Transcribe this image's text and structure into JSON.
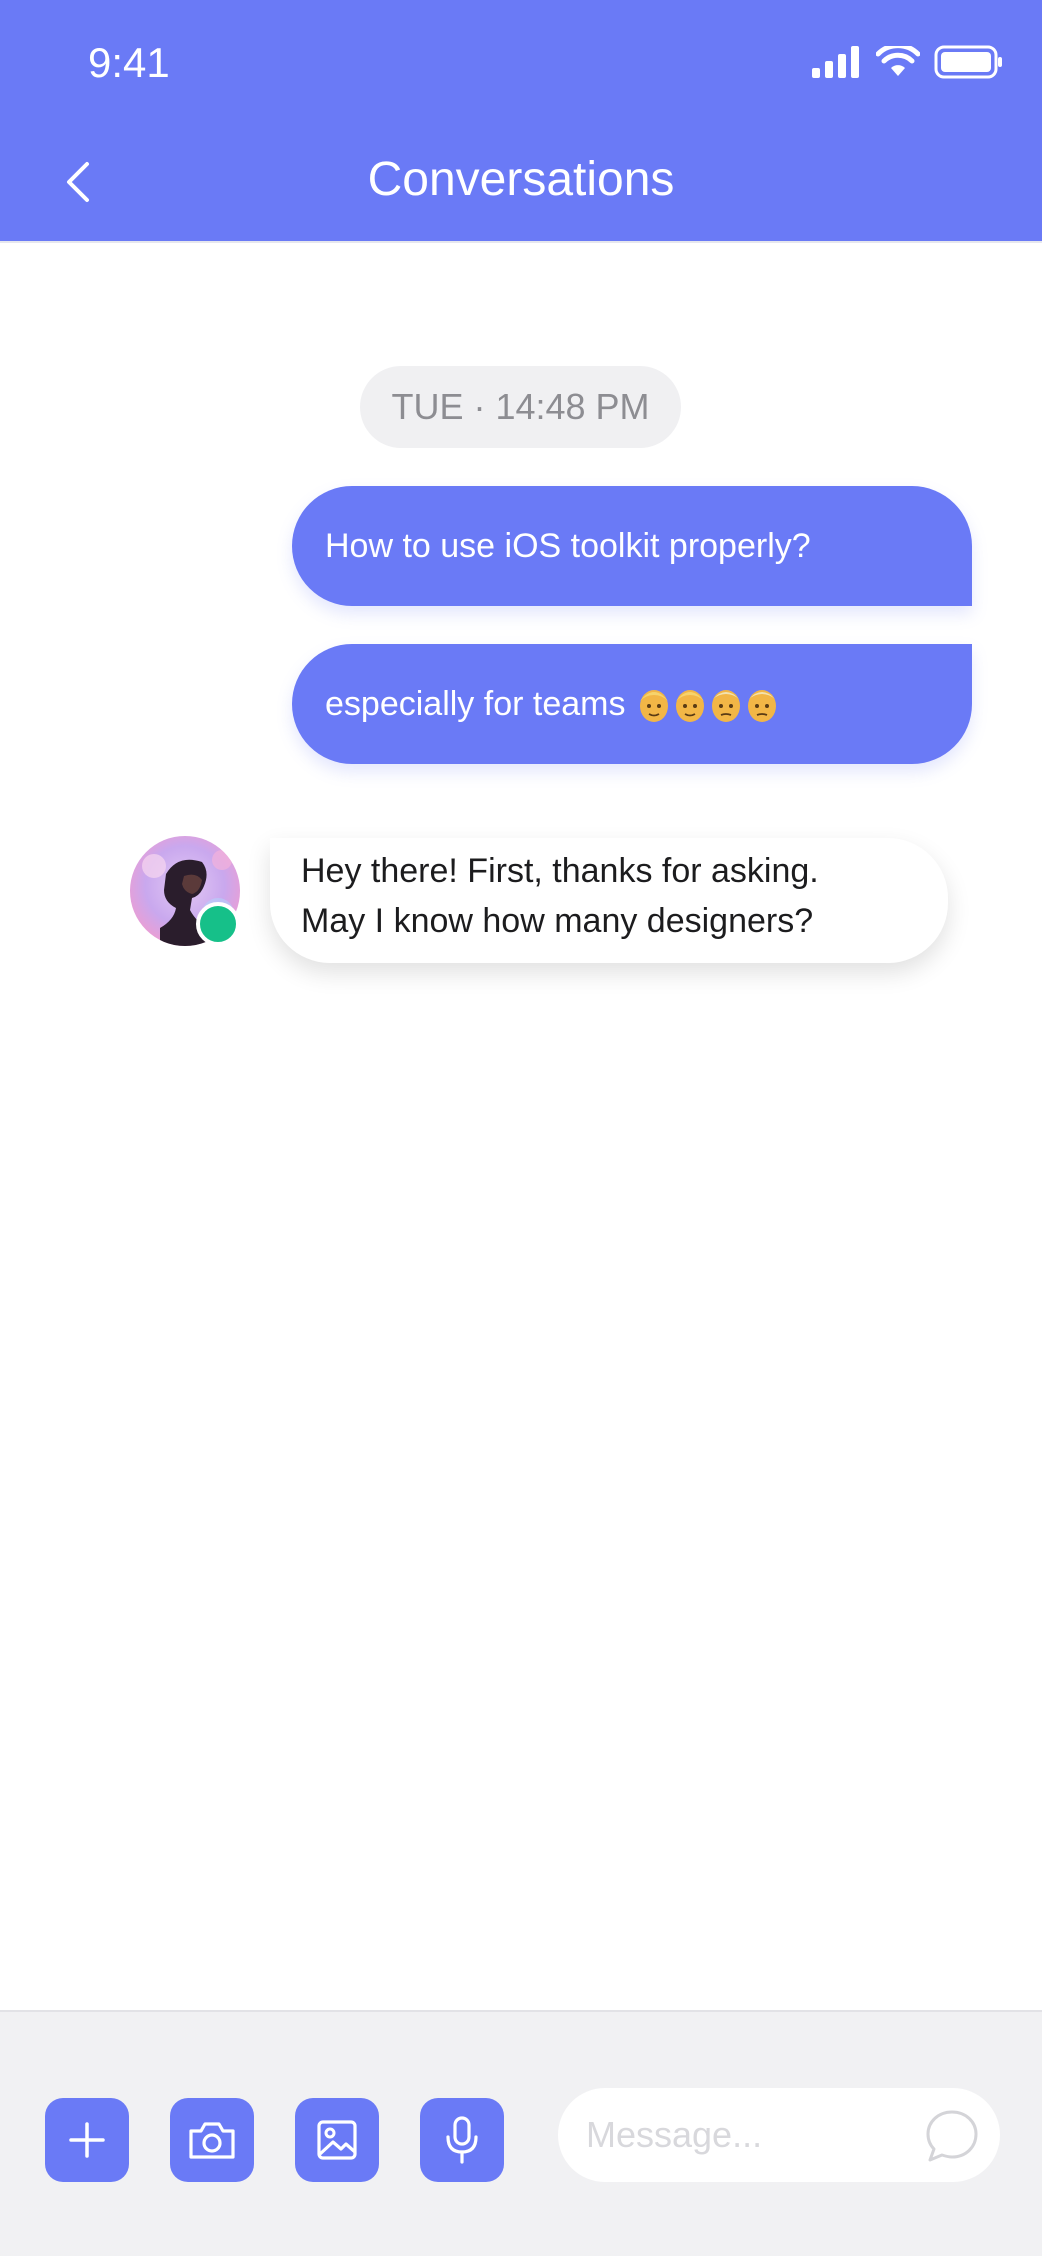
{
  "status_bar": {
    "time": "9:41",
    "icons": [
      "signal-icon",
      "wifi-icon",
      "battery-icon"
    ]
  },
  "header": {
    "title": "Conversations",
    "back_icon": "chevron-left-icon",
    "background": "#6a7af6"
  },
  "timestamp": "TUE · 14:48 PM",
  "messages": [
    {
      "direction": "outgoing",
      "text": "How to use iOS toolkit properly?"
    },
    {
      "direction": "outgoing",
      "text": "especially for teams",
      "emoji": [
        "man-emoji",
        "man-emoji",
        "older-man-emoji",
        "older-man-emoji"
      ]
    },
    {
      "direction": "incoming",
      "lines": [
        "Hey there! First, thanks for asking.",
        "May I know how many designers?"
      ],
      "avatar_status": "online"
    }
  ],
  "composer": {
    "actions": [
      "plus-icon",
      "camera-icon",
      "image-icon",
      "microphone-icon"
    ],
    "placeholder": "Message...",
    "send_icon": "chat-bubble-icon"
  },
  "colors": {
    "accent": "#6a7af6",
    "online": "#16c089",
    "bubble_incoming": "#ffffff",
    "timestamp_bg": "#f0f0f2"
  }
}
